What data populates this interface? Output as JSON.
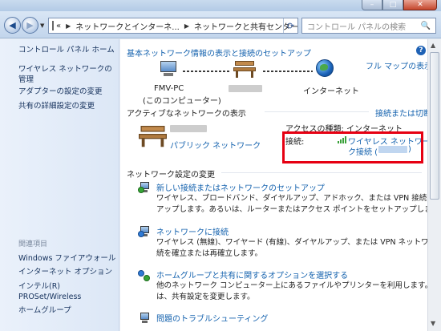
{
  "window": {
    "minimize_glyph": "–",
    "maximize_glyph": "□",
    "close_glyph": "✕"
  },
  "nav": {
    "back_glyph": "◀",
    "forward_glyph": "▶",
    "address_crumbs": [
      "«",
      "ネットワークとインターネ...",
      "ネットワークと共有センター"
    ],
    "refresh_glyph": "⟳",
    "search_placeholder": "コントロール パネルの検索",
    "search_glyph": "🔍"
  },
  "sidebar": {
    "home": "コントロール パネル ホーム",
    "items": [
      "ワイヤレス ネットワークの管理",
      "アダプターの設定の変更",
      "共有の詳細設定の変更"
    ],
    "related_heading": "関連項目",
    "related": [
      "Windows ファイアウォール",
      "インターネット オプション",
      "インテル(R) PROSet/Wireless",
      "ホームグループ"
    ]
  },
  "main": {
    "help_glyph": "?",
    "basic_title": "基本ネットワーク情報の表示と接続のセットアップ",
    "full_map_link": "フル マップの表示",
    "map": {
      "pc_name": "FMV-PC",
      "pc_sub": "(このコンピューター)",
      "internet_label": "インターネット"
    },
    "active_title": "アクティブなネットワークの表示",
    "connect_link": "接続または切断",
    "network": {
      "type_link": "パブリック ネットワーク",
      "access_type_label": "アクセスの種類:",
      "access_type_value": "インターネット",
      "connection_label": "接続:",
      "connection_value_line1": "ワイヤレス ネットワー",
      "connection_value_line2": "ク接続 (",
      "connection_value_end": ")"
    },
    "change_title": "ネットワーク設定の変更",
    "tasks": [
      {
        "link": "新しい接続またはネットワークのセットアップ",
        "desc": [
          "ワイヤレス、ブロードバンド、ダイヤルアップ、アドホック、または VPN 接続をセット",
          "アップします。あるいは、ルーターまたはアクセス ポイントをセットアップします。"
        ]
      },
      {
        "link": "ネットワークに接続",
        "desc": [
          "ワイヤレス (無線)、ワイヤード (有線)、ダイヤルアップ、または VPN ネットワーク接",
          "続を確立または再確立します。"
        ]
      },
      {
        "link": "ホームグループと共有に関するオプションを選択する",
        "desc": [
          "他のネットワーク コンピューター上にあるファイルやプリンターを利用します。また",
          "は、共有設定を変更します。"
        ]
      },
      {
        "link": "問題のトラブルシューティング",
        "desc": []
      }
    ]
  },
  "scroll": {
    "up_glyph": "▲",
    "down_glyph": "▼"
  },
  "colors": {
    "link": "#1462ae",
    "highlight_border": "#e60012",
    "sidebar_bg": "#dce7f6"
  }
}
